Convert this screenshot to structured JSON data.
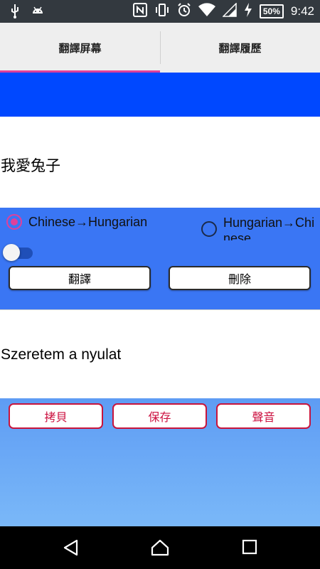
{
  "status_bar": {
    "time": "9:42",
    "battery_percent": "50%",
    "icons": [
      "usb-icon",
      "android-icon",
      "nfc-icon",
      "vibrate-icon",
      "alarm-icon",
      "wifi-icon",
      "signal-icon",
      "charging-icon",
      "battery-icon"
    ]
  },
  "tabs": [
    {
      "label": "翻譯屏幕",
      "selected": true
    },
    {
      "label": "翻譯履歷",
      "selected": false
    }
  ],
  "colors": {
    "accent": "#e0409a",
    "band_blue": "#0048ff",
    "controls_blue": "#3a76f4",
    "action_red": "#cc1140"
  },
  "source": {
    "text": "我愛兔子"
  },
  "direction": {
    "option1": "Chinese→Hungarian",
    "option2_line1": "Hungarian→Chi",
    "option2_line2": "nese",
    "selected": "option1"
  },
  "toggle": {
    "on": false
  },
  "buttons": {
    "translate": "翻譯",
    "delete": "刪除"
  },
  "result": {
    "text": "Szeretem a nyulat"
  },
  "actions": {
    "copy": "拷貝",
    "save": "保存",
    "sound": "聲音"
  },
  "nav": {
    "icons": [
      "back-icon",
      "home-icon",
      "recents-icon"
    ]
  }
}
